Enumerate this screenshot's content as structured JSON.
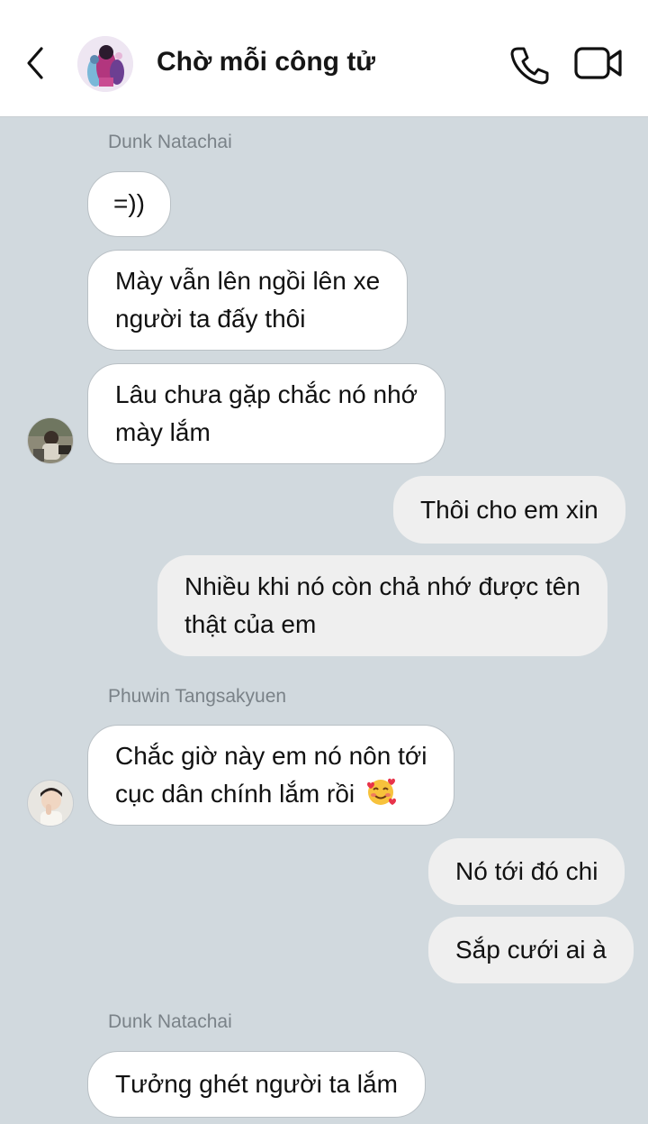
{
  "header": {
    "title": "Chờ mỗi công tử",
    "back_icon": "chevron-left-icon",
    "call_icon": "phone-icon",
    "video_icon": "video-camera-icon"
  },
  "messages": {
    "sender_1": "Dunk Natachai",
    "m1": "=))",
    "m2_line1": "Mày vẫn lên ngồi lên xe",
    "m2_line2": "người ta đấy thôi",
    "m3_line1": "Lâu chưa gặp chắc nó nhớ",
    "m3_line2": "mày lắm",
    "m4": "Thôi cho em xin",
    "m5_line1": "Nhiều khi nó còn chả nhớ được tên",
    "m5_line2": "thật của em",
    "sender_2": "Phuwin Tangsakyuen",
    "m6_line1": "Chắc giờ này em nó nôn tới",
    "m6_line2": "cục dân chính lắm rồi",
    "m6_emoji": "smiling-face-with-hearts-emoji",
    "m7": "Nó tới đó chi",
    "m8": "Sắp cưới ai à",
    "sender_3": "Dunk Natachai",
    "m9": "Tưởng ghét người ta lắm"
  },
  "colors": {
    "chat_background": "#d1d9de",
    "incoming_bubble": "#ffffff",
    "outgoing_bubble": "#efefef",
    "sender_name": "#7a8288"
  }
}
